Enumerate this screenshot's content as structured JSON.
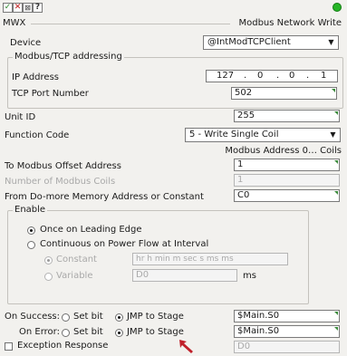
{
  "toolbar": {
    "ok_icon": "check-icon",
    "cancel_icon": "x-icon",
    "help_icon": "help-icon",
    "ok_color": "#2e8b2e",
    "cancel_color": "#c01818",
    "status_color": "#26b526"
  },
  "header": {
    "instruction": "MWX",
    "title": "Modbus Network Write"
  },
  "device": {
    "label": "Device",
    "value": "@IntModTCPClient"
  },
  "modbus_tcp": {
    "group_title": "Modbus/TCP addressing",
    "ip_label": "IP Address",
    "ip": [
      "127",
      "0",
      "0",
      "1"
    ],
    "port_label": "TCP Port Number",
    "port": "502"
  },
  "unit_id": {
    "label": "Unit ID",
    "value": "255"
  },
  "function_code": {
    "label": "Function Code",
    "value": "5 - Write Single Coil"
  },
  "modbus_address_note": "Modbus Address 0… Coils",
  "offset": {
    "label": "To Modbus Offset Address",
    "value": "1"
  },
  "num_coils": {
    "label": "Number of Modbus Coils",
    "value": "1"
  },
  "from_mem": {
    "label": "From Do-more Memory Address or Constant",
    "value": "C0"
  },
  "enable": {
    "group_title": "Enable",
    "leading_edge": "Once on Leading Edge",
    "continuous": "Continuous on Power Flow at Interval",
    "constant_label": "Constant",
    "constant_mask": "hr h   min m   sec s   ms ms",
    "variable_label": "Variable",
    "variable_value": "D0",
    "ms_label": "ms"
  },
  "on_success": {
    "label": "On Success:",
    "set_bit": "Set bit",
    "jmp": "JMP to Stage",
    "value": "$Main.S0"
  },
  "on_error": {
    "label": "On Error:",
    "set_bit": "Set bit",
    "jmp": "JMP to Stage",
    "value": "$Main.S0"
  },
  "exception": {
    "label": "Exception Response",
    "value": "D0"
  }
}
